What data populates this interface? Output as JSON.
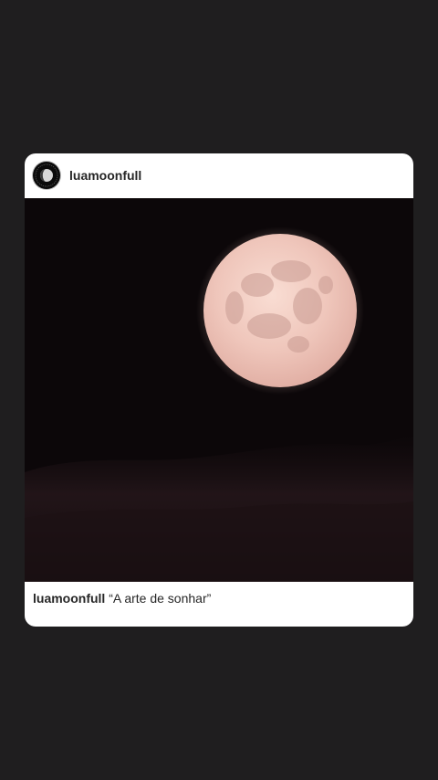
{
  "post": {
    "username": "luamoonfull",
    "avatar_icon": "moon-logo-icon",
    "image_subject": "full-moon-night-sky",
    "caption": {
      "username": "luamoonfull",
      "text": "“A arte de sonhar”"
    }
  },
  "colors": {
    "background": "#1f1e1f",
    "card": "#ffffff",
    "night_sky": "#0c0709",
    "moon": "#f0c9bf"
  }
}
